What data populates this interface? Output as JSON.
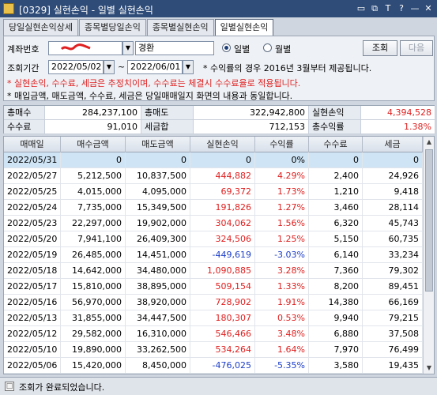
{
  "window": {
    "title": "[0329] 실현손익 - 일별 실현손익",
    "buttons": [
      "▭",
      "⧉",
      "T",
      "?",
      "—",
      "✕"
    ]
  },
  "tabs": [
    {
      "label": "당일실현손익상세",
      "active": false
    },
    {
      "label": "종목별당일손익",
      "active": false
    },
    {
      "label": "종목별실현손익",
      "active": false
    },
    {
      "label": "일별실현손익",
      "active": true
    }
  ],
  "form": {
    "account_label": "계좌번호",
    "account_value": "",
    "owner_name": "경환",
    "radio_daily": "일별",
    "radio_monthly": "월별",
    "period_label": "조회기간",
    "date_from": "2022/05/02",
    "date_to": "2022/06/01",
    "tilde": "~",
    "period_note": "* 수익률의 경우 2016년 3월부터 제공됩니다.",
    "query_button": "조회",
    "next_button": "다음"
  },
  "notices": [
    {
      "text": "* 실현손익, 수수료, 세금은 추정치이며, 수수료는 체결시 수수료율로 적용됩니다.",
      "red": true
    },
    {
      "text": "* 매입금액, 매도금액, 수수료, 세금은 당일매매일지 화면의 내용과 동일합니다.",
      "red": false
    }
  ],
  "summary": {
    "row1": [
      {
        "label": "총매수",
        "value": "284,237,100",
        "color": ""
      },
      {
        "label": "총매도",
        "value": "322,942,800",
        "color": ""
      },
      {
        "label": "실현손익",
        "value": "4,394,528",
        "color": "red"
      }
    ],
    "row2": [
      {
        "label": "수수료",
        "value": "91,010",
        "color": ""
      },
      {
        "label": "세금합",
        "value": "712,153",
        "color": ""
      },
      {
        "label": "총수익률",
        "value": "1.38%",
        "color": "red"
      }
    ]
  },
  "table": {
    "columns": [
      "매매일",
      "매수금액",
      "매도금액",
      "실현손익",
      "수익률",
      "수수료",
      "세금"
    ],
    "rows": [
      [
        "2022/05/31",
        "0",
        "0",
        "0",
        "0%",
        "0",
        "0"
      ],
      [
        "2022/05/27",
        "5,212,500",
        "10,837,500",
        "444,882",
        "4.29%",
        "2,400",
        "24,926"
      ],
      [
        "2022/05/25",
        "4,015,000",
        "4,095,000",
        "69,372",
        "1.73%",
        "1,210",
        "9,418"
      ],
      [
        "2022/05/24",
        "7,735,000",
        "15,349,500",
        "191,826",
        "1.27%",
        "3,460",
        "28,114"
      ],
      [
        "2022/05/23",
        "22,297,000",
        "19,902,000",
        "304,062",
        "1.56%",
        "6,320",
        "45,743"
      ],
      [
        "2022/05/20",
        "7,941,100",
        "26,409,300",
        "324,506",
        "1.25%",
        "5,150",
        "60,735"
      ],
      [
        "2022/05/19",
        "26,485,000",
        "14,451,000",
        "-449,619",
        "-3.03%",
        "6,140",
        "33,234"
      ],
      [
        "2022/05/18",
        "14,642,000",
        "34,480,000",
        "1,090,885",
        "3.28%",
        "7,360",
        "79,302"
      ],
      [
        "2022/05/17",
        "15,810,000",
        "38,895,000",
        "509,154",
        "1.33%",
        "8,200",
        "89,451"
      ],
      [
        "2022/05/16",
        "56,970,000",
        "38,920,000",
        "728,902",
        "1.91%",
        "14,380",
        "66,169"
      ],
      [
        "2022/05/13",
        "31,855,000",
        "34,447,500",
        "180,307",
        "0.53%",
        "9,940",
        "79,215"
      ],
      [
        "2022/05/12",
        "29,582,000",
        "16,310,000",
        "546,466",
        "3.48%",
        "6,880",
        "37,508"
      ],
      [
        "2022/05/10",
        "19,890,000",
        "33,262,500",
        "534,264",
        "1.64%",
        "7,970",
        "76,499"
      ],
      [
        "2022/05/06",
        "15,420,000",
        "8,450,000",
        "-476,025",
        "-5.35%",
        "3,580",
        "19,435"
      ],
      [
        "2022/05/04",
        "12,490,000",
        "11,264,000",
        "1,733",
        "0.02%",
        "3,560",
        "25,907"
      ]
    ]
  },
  "status": {
    "text": "조회가 완료되었습니다."
  },
  "colors": {
    "positive": "#e02020",
    "negative": "#1c3ec9",
    "titlebar": "#2f4c78",
    "selected_row": "#cfe5f6"
  }
}
